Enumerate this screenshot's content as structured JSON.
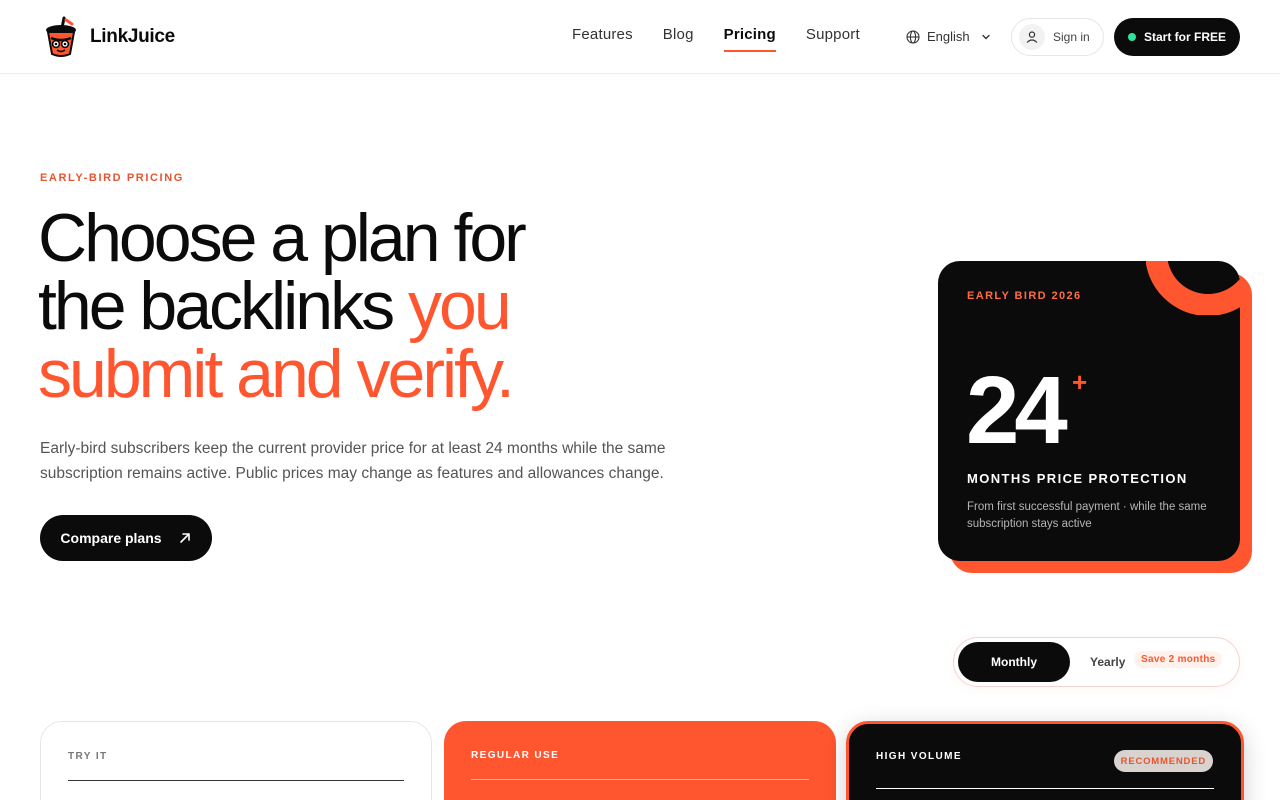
{
  "brand": {
    "name": "LinkJuice"
  },
  "nav": {
    "items": [
      {
        "label": "Features",
        "active": false
      },
      {
        "label": "Blog",
        "active": false
      },
      {
        "label": "Pricing",
        "active": true
      },
      {
        "label": "Support",
        "active": false
      }
    ],
    "language": "English",
    "signin_label": "Sign in",
    "cta_label": "Start for FREE"
  },
  "hero": {
    "eyebrow": "EARLY-BIRD PRICING",
    "headline_dark_1": "Choose a plan for",
    "headline_dark_2": "the backlinks",
    "headline_orange_1": "you",
    "headline_orange_2": "submit and verify.",
    "body": "Early-bird subscribers keep the current provider price for at least 24 months while the same subscription remains active. Public prices may change as features and allowances change.",
    "cta_label": "Compare plans"
  },
  "promo": {
    "eyebrow": "EARLY BIRD 2026",
    "number": "24",
    "plus": "+",
    "title": "MONTHS PRICE PROTECTION",
    "note": "From first successful payment · while the same subscription stays active"
  },
  "billing": {
    "monthly_label": "Monthly",
    "yearly_label": "Yearly",
    "save_badge": "Save 2 months",
    "selected": "Monthly"
  },
  "plans": [
    {
      "eyebrow": "TRY IT"
    },
    {
      "eyebrow": "REGULAR USE"
    },
    {
      "eyebrow": "HIGH VOLUME",
      "badge": "RECOMMENDED"
    }
  ],
  "colors": {
    "accent": "#ff5630",
    "dark": "#0b0b0b",
    "status_dot": "#2ee59d"
  },
  "icons": [
    "linkjuice-cup-logo",
    "globe-icon",
    "chevron-down-icon",
    "user-icon",
    "arrow-up-right-icon"
  ]
}
